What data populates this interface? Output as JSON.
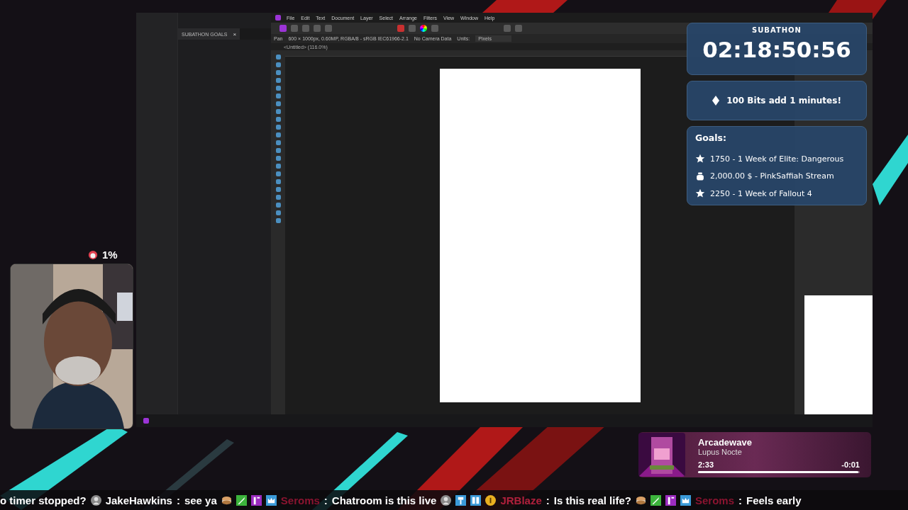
{
  "browser_panel": {
    "tab": "SUBATHON GOALS",
    "close": "×"
  },
  "app": {
    "menu": [
      "File",
      "Edit",
      "Text",
      "Document",
      "Layer",
      "Select",
      "Arrange",
      "Filters",
      "View",
      "Window",
      "Help"
    ],
    "context_bar": {
      "tool": "Pan",
      "info": "600 × 1000px, 0.60MP, RGBA/8 - sRGB IEC61966-2.1",
      "camera": "No Camera Data",
      "units_label": "Units:",
      "units": "Pixels"
    },
    "document_tab": "<Untitled> (116.0%)"
  },
  "subathon": {
    "title": "SUBATHON",
    "timer": "02:18:50:56",
    "rule": "100 Bits add 1 minutes!",
    "goals_title": "Goals:",
    "goals": [
      {
        "kind": "star",
        "text": "1750 - 1 Week of Elite: Dangerous"
      },
      {
        "kind": "moneybag",
        "text": "2,000.00 $ - PinkSaffiah Stream"
      },
      {
        "kind": "star",
        "text": "2250 - 1 Week of Fallout 4"
      }
    ]
  },
  "webcam": {
    "meter": "1%"
  },
  "now_playing": {
    "title": "Arcadewave",
    "artist": "Lupus Nocte",
    "elapsed": "2:33",
    "remaining": "-0:01",
    "level": 0.99
  },
  "chat_ticker": [
    {
      "message": "o timer stopped?"
    },
    {
      "user": "JakeHawkins",
      "color": "#ffffff",
      "separator": ":",
      "message": "see ya"
    },
    {
      "user": "Seroms",
      "color": "#8a1430",
      "separator": ":",
      "message": "Chatroom is this live"
    },
    {
      "user": "JRBlaze",
      "color": "#b0203c",
      "separator": ":",
      "message": "Is this real life?"
    },
    {
      "user": "Seroms",
      "color": "#8a1430",
      "separator": ":",
      "message": "Feels early"
    }
  ]
}
